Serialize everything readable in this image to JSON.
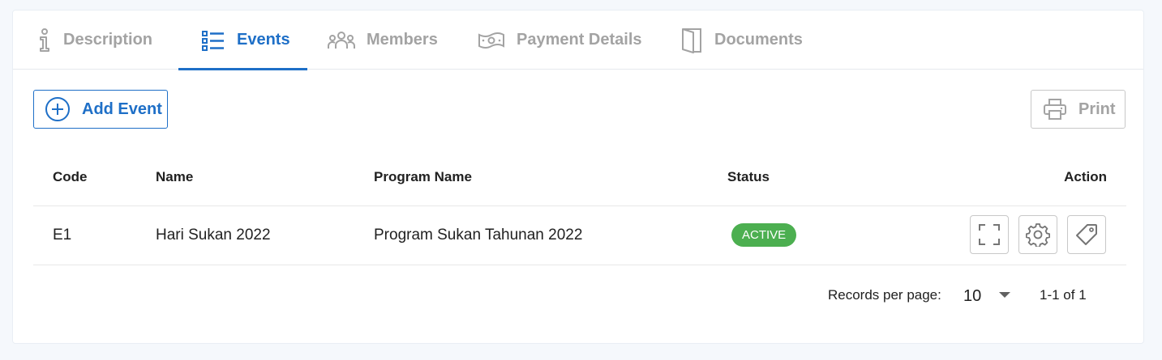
{
  "tabs": [
    {
      "label": "Description",
      "icon": "info-icon"
    },
    {
      "label": "Events",
      "icon": "list-icon",
      "active": true
    },
    {
      "label": "Members",
      "icon": "members-icon"
    },
    {
      "label": "Payment Details",
      "icon": "money-icon"
    },
    {
      "label": "Documents",
      "icon": "door-icon"
    }
  ],
  "toolbar": {
    "add_label": "Add Event",
    "print_label": "Print"
  },
  "table": {
    "headers": {
      "code": "Code",
      "name": "Name",
      "program": "Program Name",
      "status": "Status",
      "action": "Action"
    },
    "rows": [
      {
        "code": "E1",
        "name": "Hari Sukan 2022",
        "program": "Program Sukan Tahunan 2022",
        "status": "ACTIVE"
      }
    ]
  },
  "pagination": {
    "label": "Records per page:",
    "per_page": "10",
    "range": "1-1 of 1"
  },
  "colors": {
    "accent": "#1e6fc7",
    "inactive": "#a3a3a3",
    "status_active": "#4caf50"
  }
}
